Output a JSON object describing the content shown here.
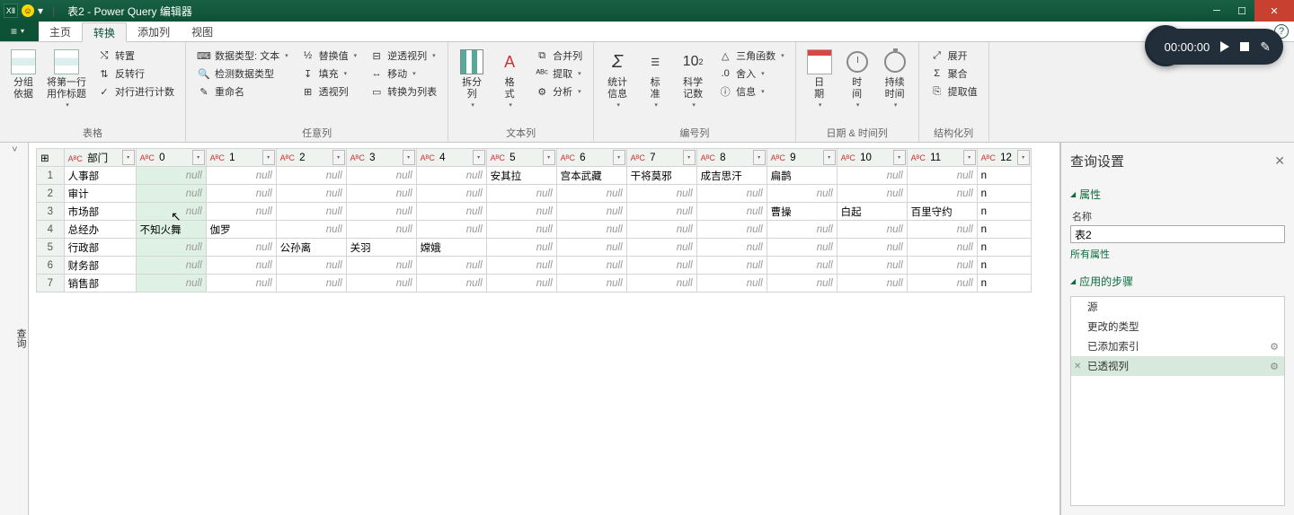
{
  "titlebar": {
    "appLabel": "XⅡ",
    "qatDown": "▾",
    "separator": "|",
    "title": "表2 - Power Query 编辑器"
  },
  "ribbon": {
    "fileLabel": "",
    "tabs": [
      {
        "label": "主页"
      },
      {
        "label": "转换",
        "active": true
      },
      {
        "label": "添加列"
      },
      {
        "label": "视图"
      }
    ],
    "groups": {
      "table": {
        "label": "表格",
        "groupBy": "分组\n依据",
        "firstRow": "将第一行\n用作标题",
        "transpose": "转置",
        "reverse": "反转行",
        "countRows": "对行进行计数"
      },
      "any": {
        "label": "任意列",
        "dataType": "数据类型: 文本",
        "detect": "检测数据类型",
        "rename": "重命名",
        "replace": "替换值",
        "fill": "填充",
        "pivot": "透视列",
        "unpivot": "逆透视列",
        "move": "移动",
        "toList": "转换为列表"
      },
      "text": {
        "label": "文本列",
        "split": "拆分\n列",
        "format": "格\n式",
        "merge": "合并列",
        "extract": "提取",
        "parse": "分析"
      },
      "number": {
        "label": "编号列",
        "stats": "统计\n信息",
        "standard": "标\n准",
        "scientific": "科学\n记数",
        "trig": "三角函数",
        "rounding": "舍入",
        "info": "信息"
      },
      "datetime": {
        "label": "日期 & 时间列",
        "date": "日\n期",
        "time": "时\n间",
        "duration": "持续\n时间"
      },
      "struct": {
        "label": "结构化列",
        "expand": "展开",
        "aggregate": "聚合",
        "extractVal": "提取值"
      }
    }
  },
  "leftGutter": {
    "label": "查询",
    "toggle": ">"
  },
  "grid": {
    "columns": [
      "部门",
      "0",
      "1",
      "2",
      "3",
      "4",
      "5",
      "6",
      "7",
      "8",
      "9",
      "10",
      "11",
      "12"
    ],
    "colType": "AᴮC",
    "rows": [
      {
        "n": 1,
        "dept": "人事部",
        "c": [
          null,
          null,
          null,
          null,
          null,
          "安其拉",
          "宫本武藏",
          "干将莫邪",
          "成吉思汗",
          "扁鹊",
          null,
          null,
          "n"
        ]
      },
      {
        "n": 2,
        "dept": "审计",
        "c": [
          null,
          null,
          null,
          null,
          null,
          null,
          null,
          null,
          null,
          null,
          null,
          null,
          "n"
        ]
      },
      {
        "n": 3,
        "dept": "市场部",
        "c": [
          null,
          null,
          null,
          null,
          null,
          null,
          null,
          null,
          null,
          "曹操",
          "白起",
          "百里守约",
          "n"
        ]
      },
      {
        "n": 4,
        "dept": "总经办",
        "c": [
          "不知火舞",
          "伽罗",
          null,
          null,
          null,
          null,
          null,
          null,
          null,
          null,
          null,
          null,
          "n"
        ]
      },
      {
        "n": 5,
        "dept": "行政部",
        "c": [
          null,
          null,
          "公孙离",
          "关羽",
          "嫦娥",
          null,
          null,
          null,
          null,
          null,
          null,
          null,
          "n"
        ]
      },
      {
        "n": 6,
        "dept": "财务部",
        "c": [
          null,
          null,
          null,
          null,
          null,
          null,
          null,
          null,
          null,
          null,
          null,
          null,
          "n"
        ]
      },
      {
        "n": 7,
        "dept": "销售部",
        "c": [
          null,
          null,
          null,
          null,
          null,
          null,
          null,
          null,
          null,
          null,
          null,
          null,
          "n"
        ]
      }
    ],
    "nullText": "null"
  },
  "rightPane": {
    "title": "查询设置",
    "propsHeader": "属性",
    "nameLabel": "名称",
    "nameValue": "表2",
    "allProps": "所有属性",
    "stepsHeader": "应用的步骤",
    "steps": [
      {
        "label": "源",
        "gear": false
      },
      {
        "label": "更改的类型",
        "gear": false
      },
      {
        "label": "已添加索引",
        "gear": true
      },
      {
        "label": "已透视列",
        "gear": true,
        "selected": true,
        "deletable": true
      }
    ]
  },
  "recorder": {
    "time": "00:00:00"
  }
}
